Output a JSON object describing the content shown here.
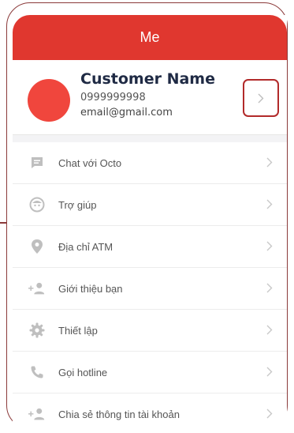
{
  "header": {
    "title": "Me"
  },
  "profile": {
    "name": "Customer Name",
    "phone": "0999999998",
    "email": "email@gmail.com"
  },
  "menu": {
    "items": [
      {
        "label": "Chat với Octo",
        "icon": "chat-icon"
      },
      {
        "label": "Trợ giúp",
        "icon": "help-face-icon"
      },
      {
        "label": "Địa chỉ ATM",
        "icon": "location-pin-icon"
      },
      {
        "label": "Giới thiệu bạn",
        "icon": "add-person-icon"
      },
      {
        "label": "Thiết lập",
        "icon": "gear-icon"
      },
      {
        "label": "Gọi hotline",
        "icon": "phone-icon"
      },
      {
        "label": "Chia sẻ thông tin tài khoản",
        "icon": "share-person-icon"
      }
    ]
  },
  "colors": {
    "accent": "#e0372f",
    "avatar": "#f0463d",
    "highlight_border": "#b22a2a"
  }
}
